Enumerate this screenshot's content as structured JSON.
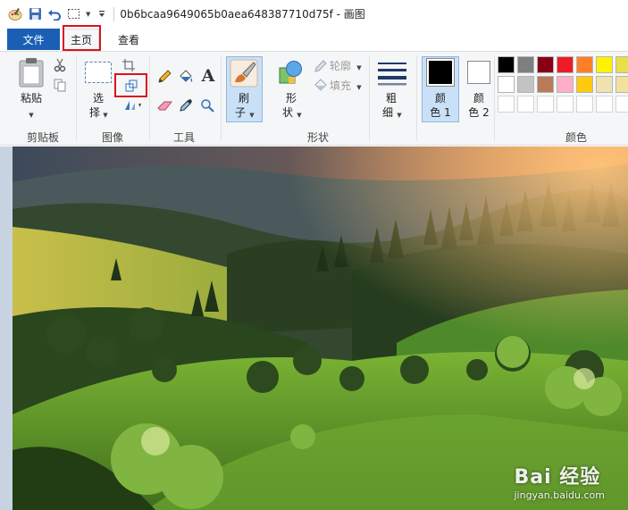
{
  "window": {
    "title": "0b6bcaa9649065b0aea648387710d75f - 画图"
  },
  "tabs": {
    "file": "文件",
    "home": "主页",
    "view": "查看"
  },
  "ribbon": {
    "clipboard": {
      "paste": "粘贴",
      "group": "剪贴板"
    },
    "image": {
      "select_1": "选",
      "select_2": "择",
      "group": "图像"
    },
    "tools": {
      "group": "工具",
      "text_glyph": "A"
    },
    "brush": {
      "label_1": "刷",
      "label_2": "子"
    },
    "shapes": {
      "shape_1": "形",
      "shape_2": "状",
      "outline": "轮廓",
      "fill": "填充",
      "group": "形状"
    },
    "size": {
      "label_1": "粗",
      "label_2": "细"
    },
    "color1": {
      "label_1": "颜",
      "label_2": "色 1"
    },
    "color2": {
      "label_1": "颜",
      "label_2": "色 2"
    },
    "colors": {
      "group": "颜色",
      "row1": [
        "#000000",
        "#7f7f7f",
        "#880015",
        "#ed1c24",
        "#ff7f27",
        "#fff200",
        "#e8e04a"
      ],
      "row2": [
        "#ffffff",
        "#c3c3c3",
        "#b97a57",
        "#ffaec9",
        "#ffc90e",
        "#efe4b0",
        "#f2e29b"
      ]
    }
  },
  "watermark": {
    "main": "Bai 经验",
    "sub": "jingyan.baidu.com"
  }
}
